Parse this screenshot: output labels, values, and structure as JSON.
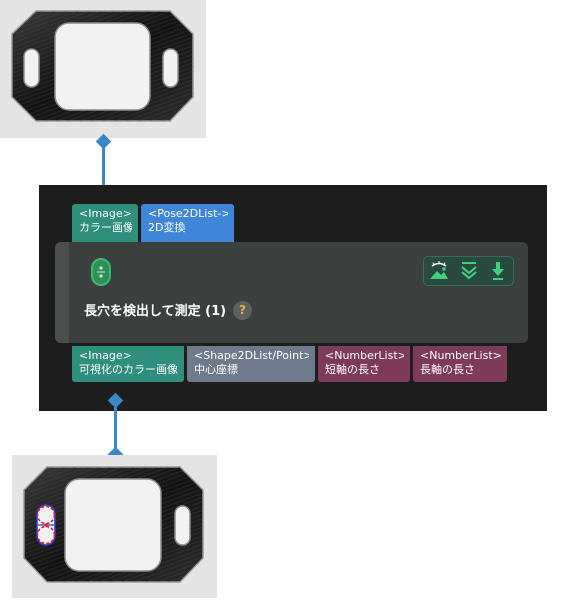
{
  "node": {
    "title": "長穴を検出して測定 (1)",
    "help": "?",
    "inputs": [
      {
        "type": "<Image>",
        "label": "カラー画像"
      },
      {
        "type": "<Pose2DList->",
        "label": "2D変換"
      }
    ],
    "outputs": [
      {
        "type": "<Image>",
        "label": "可視化のカラー画像"
      },
      {
        "type": "<Shape2DList/Point>",
        "label": "中心座標"
      },
      {
        "type": "<NumberList>",
        "label": "短軸の長さ"
      },
      {
        "type": "<NumberList>",
        "label": "長軸の長さ"
      }
    ],
    "toolbar_icons": [
      "visualize-eye-landscape-icon",
      "collapse-chevron-icon",
      "download-arrow-icon"
    ]
  },
  "colors": {
    "connector": "#3a86c9",
    "image_port": "#2f8e7c",
    "pose_port": "#3f86d8",
    "shape_port": "#6e7a8c",
    "number_port": "#7d3a59",
    "node_bg": "#3b3f3d",
    "panel_bg": "#1d1d1d",
    "detect_highlight": "#e0202a"
  }
}
